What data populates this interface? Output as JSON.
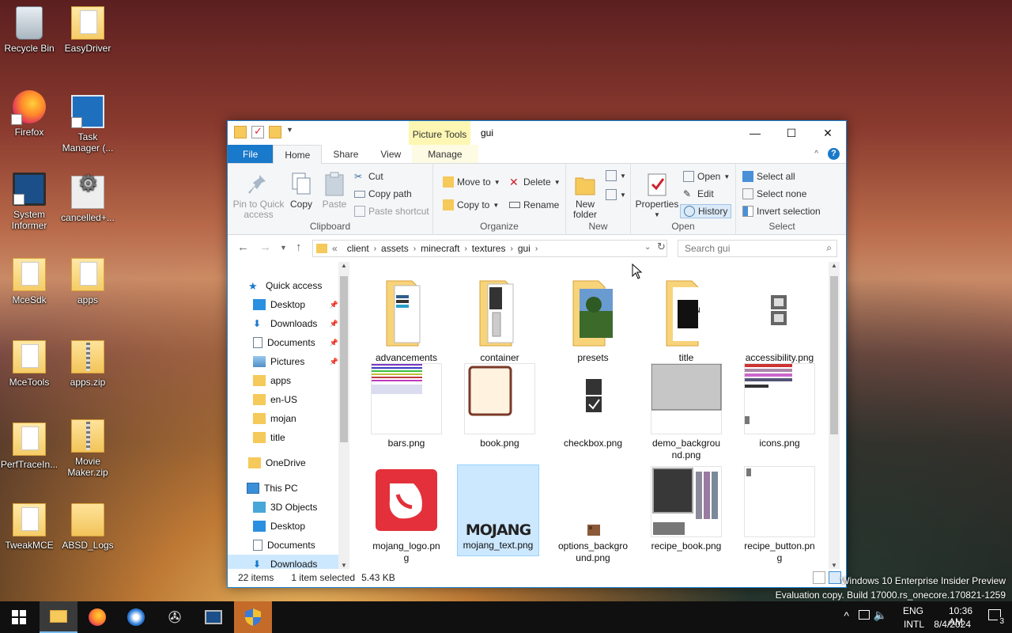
{
  "desktop": {
    "icons": [
      {
        "label": "Recycle Bin"
      },
      {
        "label": "EasyDriver"
      },
      {
        "label": "Firefox"
      },
      {
        "label": "Task Manager (..."
      },
      {
        "label": "System Informer"
      },
      {
        "label": "cancelled+..."
      },
      {
        "label": "MceSdk"
      },
      {
        "label": "apps"
      },
      {
        "label": "MceTools"
      },
      {
        "label": "apps.zip"
      },
      {
        "label": "PerfTraceIn..."
      },
      {
        "label": "Movie Maker.zip"
      },
      {
        "label": "TweakMCE"
      },
      {
        "label": "ABSD_Logs"
      }
    ]
  },
  "window": {
    "title": "gui",
    "contextual_tab": "Picture Tools",
    "tabs": {
      "file": "File",
      "home": "Home",
      "share": "Share",
      "view": "View",
      "manage": "Manage"
    },
    "ribbon": {
      "clipboard": {
        "label": "Clipboard",
        "pin": "Pin to Quick access",
        "copy": "Copy",
        "paste": "Paste",
        "cut": "Cut",
        "copy_path": "Copy path",
        "paste_shortcut": "Paste shortcut"
      },
      "organize": {
        "label": "Organize",
        "move_to": "Move to",
        "copy_to": "Copy to",
        "delete": "Delete",
        "rename": "Rename"
      },
      "new": {
        "label": "New",
        "new_folder": "New folder"
      },
      "open": {
        "label": "Open",
        "properties": "Properties",
        "open": "Open",
        "edit": "Edit",
        "history": "History"
      },
      "select": {
        "label": "Select",
        "select_all": "Select all",
        "select_none": "Select none",
        "invert": "Invert selection"
      }
    },
    "address": {
      "prefix": "«",
      "crumbs": [
        "client",
        "assets",
        "minecraft",
        "textures",
        "gui"
      ]
    },
    "search_placeholder": "Search gui",
    "nav": {
      "quick_access": "Quick access",
      "items": [
        "Desktop",
        "Downloads",
        "Documents",
        "Pictures",
        "apps",
        "en-US",
        "mojan",
        "title"
      ],
      "onedrive": "OneDrive",
      "this_pc": "This PC",
      "pc_items": [
        "3D Objects",
        "Desktop",
        "Documents",
        "Downloads"
      ]
    },
    "files": [
      {
        "name": "advancements"
      },
      {
        "name": "container"
      },
      {
        "name": "presets"
      },
      {
        "name": "title"
      },
      {
        "name": "accessibility.png"
      },
      {
        "name": "bars.png"
      },
      {
        "name": "book.png"
      },
      {
        "name": "checkbox.png"
      },
      {
        "name": "demo_backgrou\nnd.png"
      },
      {
        "name": "icons.png"
      },
      {
        "name": "mojang_logo.pn\ng"
      },
      {
        "name": "mojang_text.png",
        "thumb_text": "MOJANG"
      },
      {
        "name": "options_backgro\nund.png"
      },
      {
        "name": "recipe_book.png"
      },
      {
        "name": "recipe_button.pn\ng"
      }
    ],
    "status": {
      "items": "22 items",
      "selected": "1 item selected",
      "size": "5.43 KB"
    }
  },
  "watermark": {
    "line1": "Windows 10 Enterprise Insider Preview",
    "line2": "Evaluation copy. Build 17000.rs_onecore.170821-1259"
  },
  "tray": {
    "lang1": "ENG",
    "lang2": "INTL",
    "time": "10:36 AM",
    "date": "8/4/2024",
    "notifications": "3"
  },
  "colors": {
    "accent": "#1979ca",
    "selection": "#cce8ff",
    "mojang_red": "#e3303a"
  }
}
